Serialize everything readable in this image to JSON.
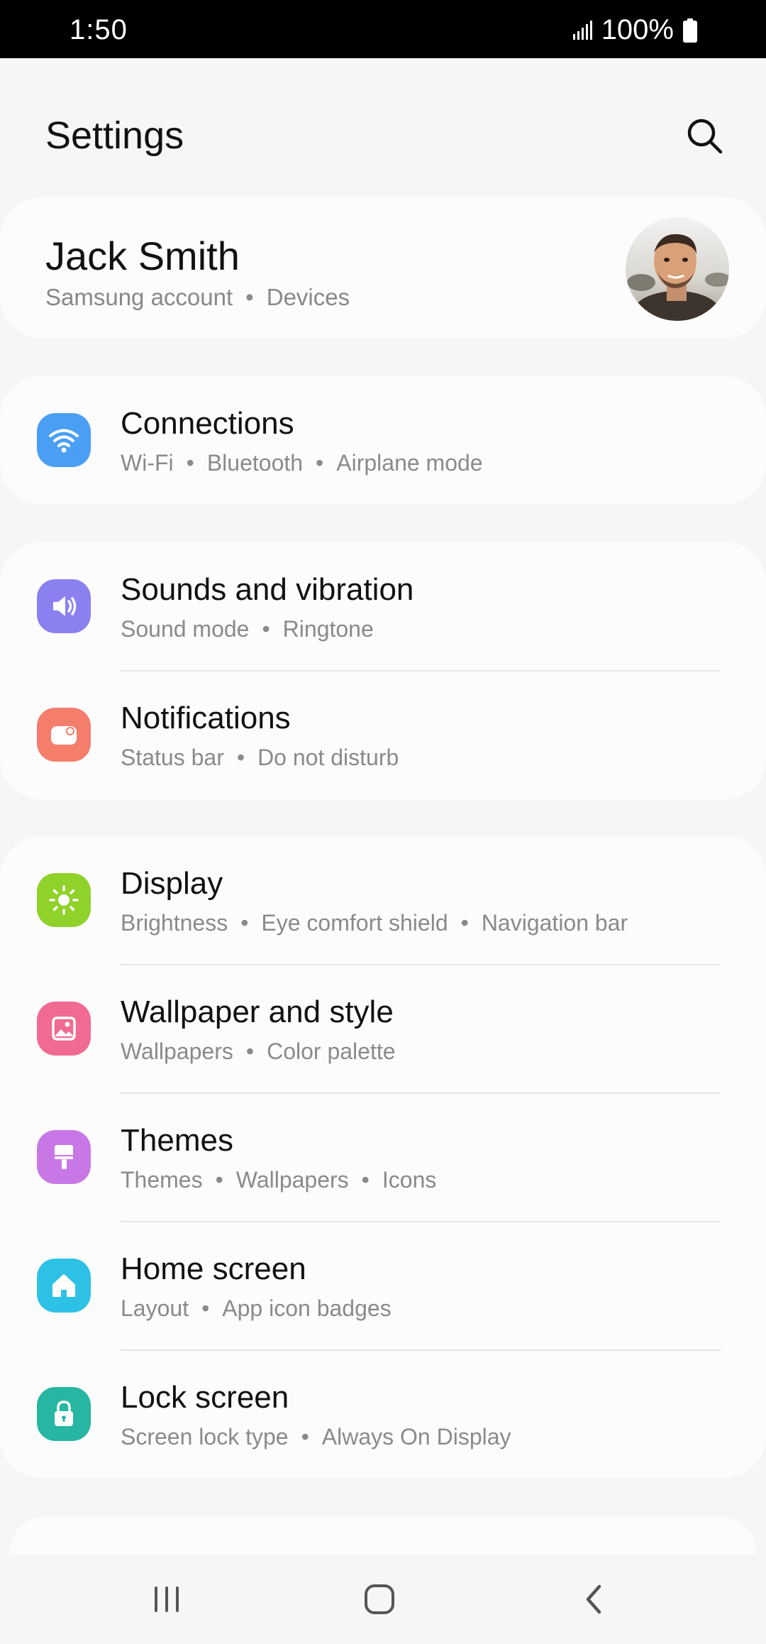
{
  "status_bar": {
    "time": "1:50",
    "battery": "100%"
  },
  "header": {
    "title": "Settings"
  },
  "account": {
    "name": "Jack Smith",
    "links": [
      "Samsung account",
      "Devices"
    ]
  },
  "items": [
    {
      "title": "Connections",
      "subtitle": [
        "Wi-Fi",
        "Bluetooth",
        "Airplane mode"
      ],
      "icon": "wifi-icon",
      "color": "#4a9ff5"
    },
    {
      "title": "Sounds and vibration",
      "subtitle": [
        "Sound mode",
        "Ringtone"
      ],
      "icon": "volume-icon",
      "color": "#8b80f0"
    },
    {
      "title": "Notifications",
      "subtitle": [
        "Status bar",
        "Do not disturb"
      ],
      "icon": "notification-icon",
      "color": "#f47d6c"
    },
    {
      "title": "Display",
      "subtitle": [
        "Brightness",
        "Eye comfort shield",
        "Navigation bar"
      ],
      "icon": "sun-icon",
      "color": "#8fd22a"
    },
    {
      "title": "Wallpaper and style",
      "subtitle": [
        "Wallpapers",
        "Color palette"
      ],
      "icon": "image-icon",
      "color": "#f06a92"
    },
    {
      "title": "Themes",
      "subtitle": [
        "Themes",
        "Wallpapers",
        "Icons"
      ],
      "icon": "brush-icon",
      "color": "#c878e6"
    },
    {
      "title": "Home screen",
      "subtitle": [
        "Layout",
        "App icon badges"
      ],
      "icon": "home-icon",
      "color": "#2ec1e6"
    },
    {
      "title": "Lock screen",
      "subtitle": [
        "Screen lock type",
        "Always On Display"
      ],
      "icon": "lock-icon",
      "color": "#26b6a2"
    }
  ]
}
